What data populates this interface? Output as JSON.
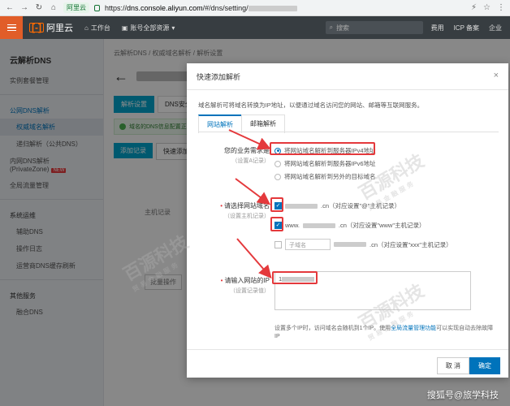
{
  "browser": {
    "site_badge": "阿里云",
    "url_prefix": "https://",
    "url_host": "dns.console.aliyun.com",
    "url_path": "/#/dns/setting/"
  },
  "header": {
    "logo": "阿里云",
    "workbench": "工作台",
    "account_switch": "账号全部资源",
    "search_placeholder": "搜索",
    "right_links": [
      "费用",
      "ICP 备案",
      "企业"
    ]
  },
  "sidebar": {
    "title": "云解析DNS",
    "items": [
      {
        "label": "实例套餐管理",
        "type": "item"
      },
      {
        "label": "公网DNS解析",
        "type": "group"
      },
      {
        "label": "权威域名解析",
        "type": "sub",
        "active": true
      },
      {
        "label": "递归解析（公共DNS）",
        "type": "sub"
      },
      {
        "label": "内网DNS解析 (PrivateZone)",
        "type": "item",
        "tag": "NEW"
      },
      {
        "label": "全局流量管理",
        "type": "item"
      },
      {
        "label": "系统运维",
        "type": "group"
      },
      {
        "label": "辅助DNS",
        "type": "sub"
      },
      {
        "label": "操作日志",
        "type": "sub"
      },
      {
        "label": "运营商DNS缓存刷新",
        "type": "sub"
      },
      {
        "label": "其他服务",
        "type": "group"
      },
      {
        "label": "融合DNS",
        "type": "sub"
      }
    ]
  },
  "main": {
    "breadcrumb": "云解析DNS  /  权威域名解析  /  解析设置",
    "tabs": [
      "解析设置",
      "DNS安全"
    ],
    "notice": "域名的DNS信息配置正",
    "add_record": "添加记录",
    "quick_add": "快速添加解",
    "host_filter": "主机记录",
    "batch_action": "批量操作"
  },
  "modal": {
    "title": "快速添加解析",
    "close": "×",
    "description": "域名解析可将域名转换为IP地址，以便通过域名访问您的网站、邮箱等互联网服务。",
    "tabs": [
      "网站解析",
      "邮箱解析"
    ],
    "need_label": "您的业务需求是",
    "need_hint": "（设置A记录）",
    "options": [
      {
        "label": "将网站域名解析到服务器IPv4地址",
        "checked": true
      },
      {
        "label": "将网站域名解析到服务器IPv6地址",
        "checked": false
      },
      {
        "label": "将网站域名解析到另外的目标域名",
        "checked": false
      }
    ],
    "domain_label": "请选择网站域名",
    "domain_hint": "（设置主机记录）",
    "domain_rows": [
      {
        "suffix": ".cn（对应设置\"@\"主机记录）",
        "checked": true
      },
      {
        "prefix": "www.",
        "suffix": ".cn（对应设置\"www\"主机记录）",
        "checked": true
      },
      {
        "sub_placeholder": "子域名",
        "suffix": ".cn（对应设置\"xxx\"主机记录）",
        "checked": false
      }
    ],
    "ip_label": "请输入网站的IP",
    "ip_hint": "（设置记录值）",
    "ip_value": "1",
    "note_pre": "设置多个IP时，访问域名会随机到1个IP。使用",
    "note_link": "全局流量管理功能",
    "note_post": "可以实现自动去除故障IP",
    "cancel": "取 消",
    "confirm": "确定"
  },
  "watermark": {
    "text": "百源科技",
    "sub": "贸易金融服务"
  },
  "credit": "搜狐号@旅学科技"
}
